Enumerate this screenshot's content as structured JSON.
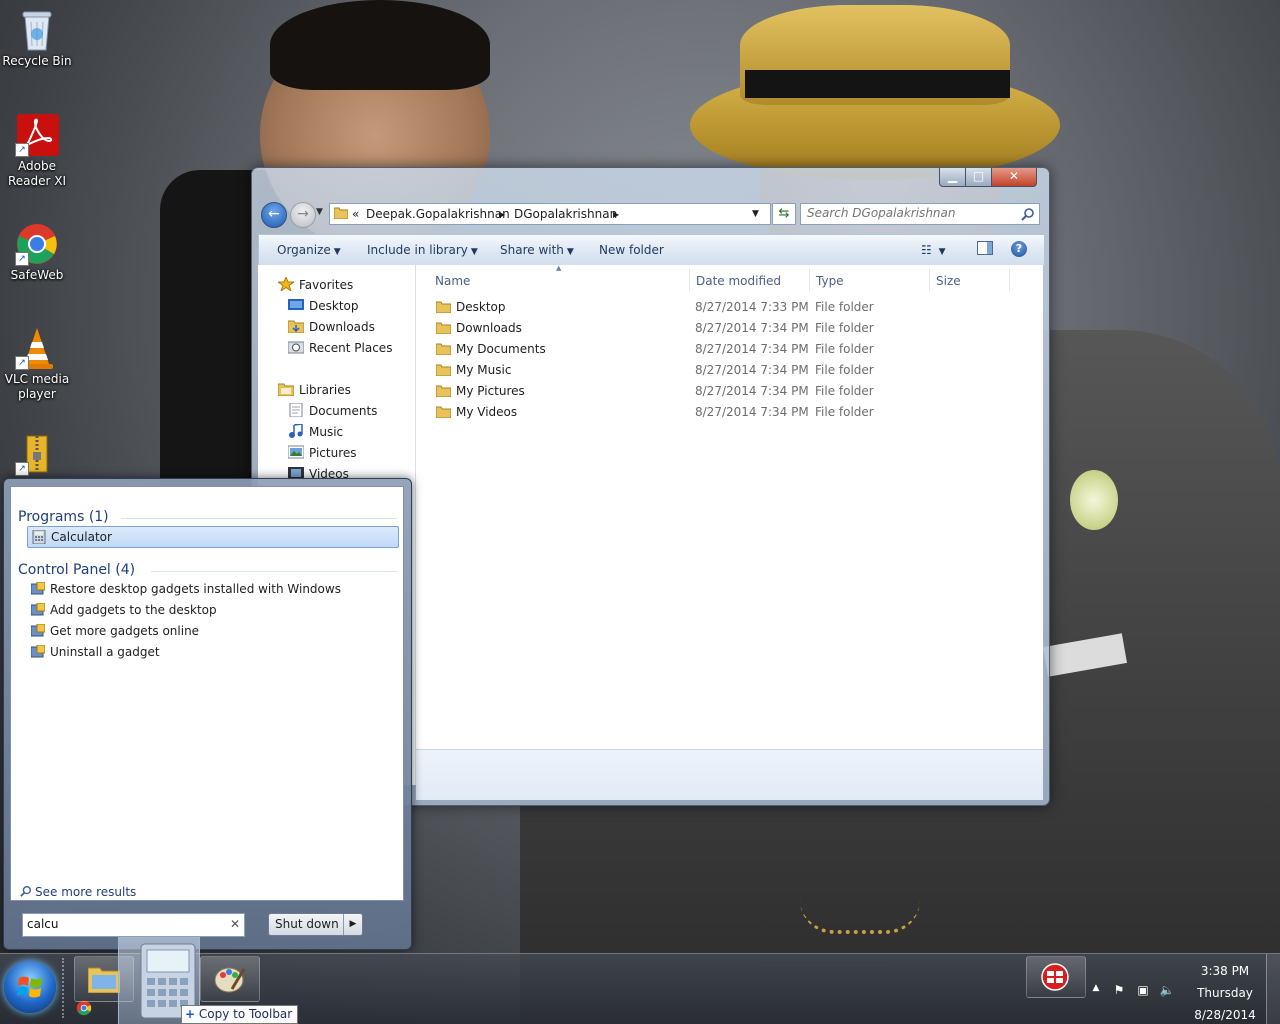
{
  "desktop_icons": [
    {
      "label": "Recycle Bin",
      "icon": "recycle-bin-icon"
    },
    {
      "label": "Adobe Reader XI",
      "icon": "adobe-reader-icon"
    },
    {
      "label": "SafeWeb",
      "icon": "chrome-icon"
    },
    {
      "label": "VLC media player",
      "icon": "vlc-icon"
    },
    {
      "label": "",
      "icon": "winzip-icon"
    }
  ],
  "explorer": {
    "address": {
      "overflow": "«",
      "crumbs": [
        "Deepak.Gopalakrishnan",
        "DGopalakrishnan"
      ]
    },
    "search_placeholder": "Search DGopalakrishnan",
    "commands": {
      "organize": "Organize",
      "include_in_library": "Include in library",
      "share_with": "Share with",
      "new_folder": "New folder"
    },
    "nav_pane": {
      "favorites": {
        "label": "Favorites",
        "items": [
          "Desktop",
          "Downloads",
          "Recent Places"
        ]
      },
      "libraries": {
        "label": "Libraries",
        "items": [
          "Documents",
          "Music",
          "Pictures",
          "Videos"
        ]
      }
    },
    "columns": {
      "name": "Name",
      "date_modified": "Date modified",
      "type": "Type",
      "size": "Size"
    },
    "files": [
      {
        "name": "Desktop",
        "date": "8/27/2014 7:33 PM",
        "type": "File folder"
      },
      {
        "name": "Downloads",
        "date": "8/27/2014 7:34 PM",
        "type": "File folder"
      },
      {
        "name": "My Documents",
        "date": "8/27/2014 7:34 PM",
        "type": "File folder"
      },
      {
        "name": "My Music",
        "date": "8/27/2014 7:34 PM",
        "type": "File folder"
      },
      {
        "name": "My Pictures",
        "date": "8/27/2014 7:34 PM",
        "type": "File folder"
      },
      {
        "name": "My Videos",
        "date": "8/27/2014 7:34 PM",
        "type": "File folder"
      }
    ]
  },
  "start_menu": {
    "programs_heading": "Programs (1)",
    "programs": [
      "Calculator"
    ],
    "control_panel_heading": "Control Panel (4)",
    "control_panel": [
      "Restore desktop gadgets installed with Windows",
      "Add gadgets to the desktop",
      "Get more gadgets online",
      "Uninstall a gadget"
    ],
    "see_more": "See more results",
    "search_value": "calcu",
    "shutdown_label": "Shut down"
  },
  "taskbar": {
    "drag_tooltip": "Copy to Toolbar",
    "clock": {
      "time": "3:38 PM",
      "day": "Thursday",
      "date": "8/28/2014"
    }
  },
  "colors": {
    "accent": "#1d5bb4",
    "selection": "#c1d9f6"
  }
}
